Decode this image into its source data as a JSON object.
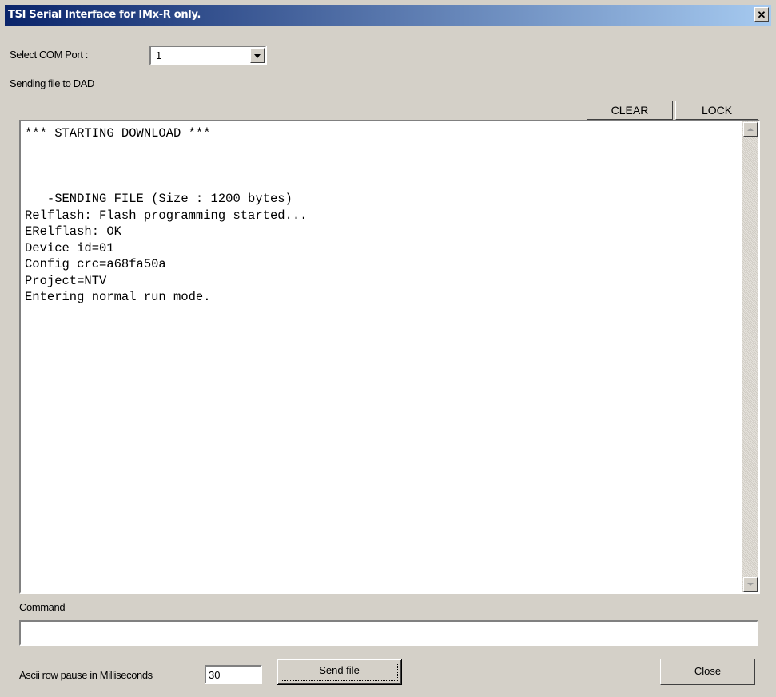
{
  "window": {
    "title": "TSI Serial Interface for IMx-R only.",
    "close_glyph": "✕"
  },
  "com_port": {
    "label": "Select COM Port :",
    "value": "1"
  },
  "status_text": "Sending file to DAD",
  "toolbar": {
    "clear_label": "CLEAR",
    "lock_label": "LOCK"
  },
  "output_lines": [
    "*** STARTING DOWNLOAD ***",
    "",
    "",
    "",
    "   -SENDING FILE (Size : 1200 bytes)",
    "Relflash: Flash programming started...",
    "ERelflash: OK",
    "Device id=01",
    "Config crc=a68fa50a",
    "Project=NTV",
    "Entering normal run mode."
  ],
  "command": {
    "label": "Command",
    "value": ""
  },
  "pause": {
    "label": "Ascii row pause in Milliseconds",
    "value": "30"
  },
  "buttons": {
    "send_file": "Send file",
    "close": "Close"
  }
}
